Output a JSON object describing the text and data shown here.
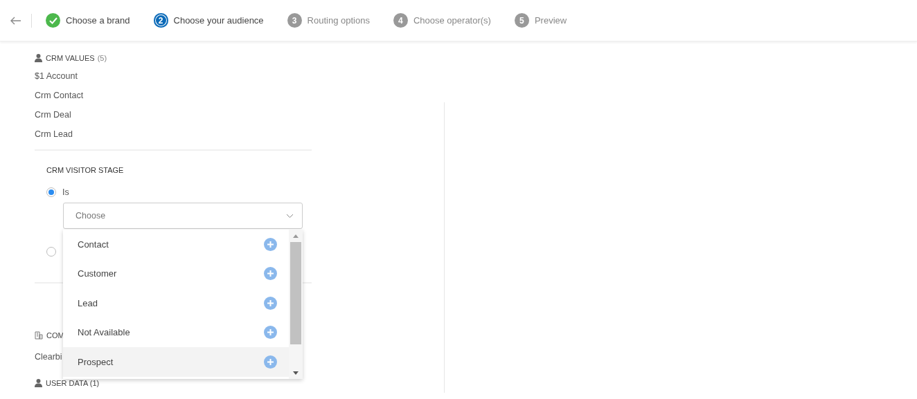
{
  "steps": [
    {
      "label": "Choose a brand",
      "kind": "done"
    },
    {
      "number": "2",
      "label": "Choose your audience",
      "kind": "current"
    },
    {
      "number": "3",
      "label": "Routing options",
      "kind": "pending"
    },
    {
      "number": "4",
      "label": "Choose operator(s)",
      "kind": "pending"
    },
    {
      "number": "5",
      "label": "Preview",
      "kind": "pending"
    }
  ],
  "crm_values": {
    "title": "CRM VALUES",
    "count": "(5)",
    "items": [
      "$1 Account",
      "Crm Contact",
      "Crm Deal",
      "Crm Lead"
    ]
  },
  "visitor_stage": {
    "title": "CRM VISITOR STAGE",
    "radios": [
      {
        "label": "Is",
        "selected": true
      },
      {
        "selected": false
      }
    ],
    "select": {
      "placeholder": "Choose",
      "options": [
        {
          "label": "Contact",
          "highlighted": false
        },
        {
          "label": "Customer",
          "highlighted": false
        },
        {
          "label": "Lead",
          "highlighted": false
        },
        {
          "label": "Not Available",
          "highlighted": false
        },
        {
          "label": "Prospect",
          "highlighted": true
        }
      ]
    }
  },
  "company": {
    "title": "COM",
    "items": [
      "Clearbi"
    ]
  },
  "user_data": {
    "title": "USER DATA (1)"
  }
}
